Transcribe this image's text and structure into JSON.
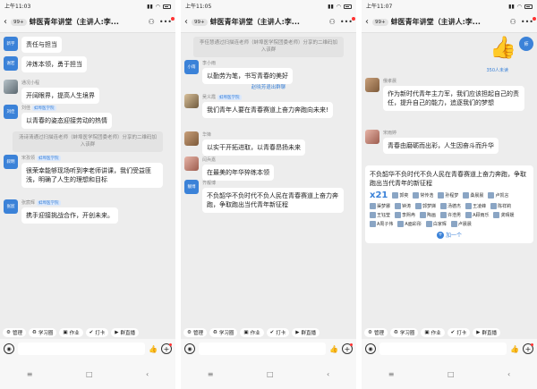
{
  "colors": {
    "accent": "#3b82d8",
    "bg": "#ededed",
    "bubble": "#ffffff"
  },
  "common": {
    "badge": "99+",
    "title": "蚌医青年讲堂（主讲人:李...",
    "toolbar": [
      {
        "icon": "⚙",
        "label": "管理"
      },
      {
        "icon": "♻",
        "label": "学习圈"
      },
      {
        "icon": "▣",
        "label": "作业"
      },
      {
        "icon": "✔",
        "label": "打卡"
      },
      {
        "icon": "▶",
        "label": "群直播"
      }
    ]
  },
  "panels": [
    {
      "time": "上午11:03",
      "items": [
        {
          "kind": "msg",
          "avatar": "新宇",
          "name": "",
          "tag": "",
          "text": "责任与担当"
        },
        {
          "kind": "msg",
          "avatar": "谢若",
          "name": "",
          "tag": "",
          "text": "淬炼本领，勇于担当"
        },
        {
          "kind": "msg",
          "avatar": "",
          "name": "通况小程",
          "tag": "",
          "text": "开阔眼界，提高人生境界"
        },
        {
          "kind": "msg",
          "avatar": "刘佳",
          "name": "刘佳",
          "tag": "蚌埠医学院",
          "text": "以青春的姿态迎接劳动的热情"
        },
        {
          "kind": "sys",
          "text": "汤诗清通过扫描连老师（蚌埠医学院团委老师）分享的二维码加入该群"
        },
        {
          "kind": "msg",
          "avatar": "叙明",
          "name": "宋孜领",
          "tag": "蚌埠医学院",
          "text": "很荣幸能够现场听到李老师讲课，我们受益匪浅，明确了人生的理想和目标"
        },
        {
          "kind": "msg",
          "avatar": "张宸",
          "name": "张宸辉",
          "tag": "蚌埠医学院",
          "text": "携手迎接挑战合作，开创未来。"
        }
      ]
    },
    {
      "time": "上午11:05",
      "items": [
        {
          "kind": "sys",
          "text": "李佳慧通过扫描连老师（蚌埠医学院团委老师）分享的二维码加入该群"
        },
        {
          "kind": "msg",
          "avatar": "小雨",
          "name": "李小雨",
          "tag": "",
          "text": "以勤劳为笔，书写青春的美好"
        },
        {
          "kind": "link",
          "text": "赵晓芳退出群聊"
        },
        {
          "kind": "msg",
          "avatar": "",
          "name": "吴义霞",
          "tag": "蚌埠医学院",
          "text": "我们青年人要在青春赛道上奋力奔跑向未来!"
        },
        {
          "kind": "msg",
          "avatar": "",
          "name": "华锋",
          "tag": "",
          "text": "以实干开拓进取，以青春昂扬未来"
        },
        {
          "kind": "msg",
          "avatar": "",
          "name": "闫兵嘉",
          "tag": "",
          "text": "在最美的年华猝练本领"
        },
        {
          "kind": "msg",
          "avatar": "靓博",
          "name": "齐靓博",
          "tag": "",
          "text": "不负韶华不负时代不负人民在青春赛道上奋力奔跑，争取跑出当代青年新征程"
        }
      ]
    },
    {
      "time": "上午11:07",
      "self_avatar": "师",
      "unread": "350人未读",
      "items": [
        {
          "kind": "msg",
          "avatar": "",
          "name": "俄孝晨",
          "tag": "",
          "text": "作为新时代青年主力军，我们应该担起自己的责任，提升自己的能力，追逐我们的梦想"
        },
        {
          "kind": "msg",
          "avatar": "",
          "name": "宋雨婷",
          "tag": "",
          "text": "青春由磨砺而出彩，人生因奋斗而升华"
        }
      ],
      "card": {
        "title": "不负韶华不负时代不负人民在青春赛道上奋力奔跑，争取跑出当代青年的新征程",
        "count": "x21",
        "people": [
          "郭奕",
          "常传浩",
          "孙程梦",
          "桑晨晨",
          "卢凯言",
          "渠梦娜",
          "钟涛",
          "郭梦娣",
          "汤德杰",
          "王凌峰",
          "陈祥莉",
          "王钰莹",
          "李熙冉",
          "陶画",
          "许浩男",
          "A顾雨乐",
          "龚晴媛",
          "A周子伟",
          "A面彩彤",
          "白家辉",
          "卢晨晨"
        ],
        "join": "加一个"
      }
    }
  ],
  "icons": {
    "back": "chevron-left-icon",
    "group": "group-icon",
    "more": "more-dots-icon",
    "voice": "voice-icon",
    "like": "thumbs-up-icon",
    "plus": "plus-icon"
  }
}
